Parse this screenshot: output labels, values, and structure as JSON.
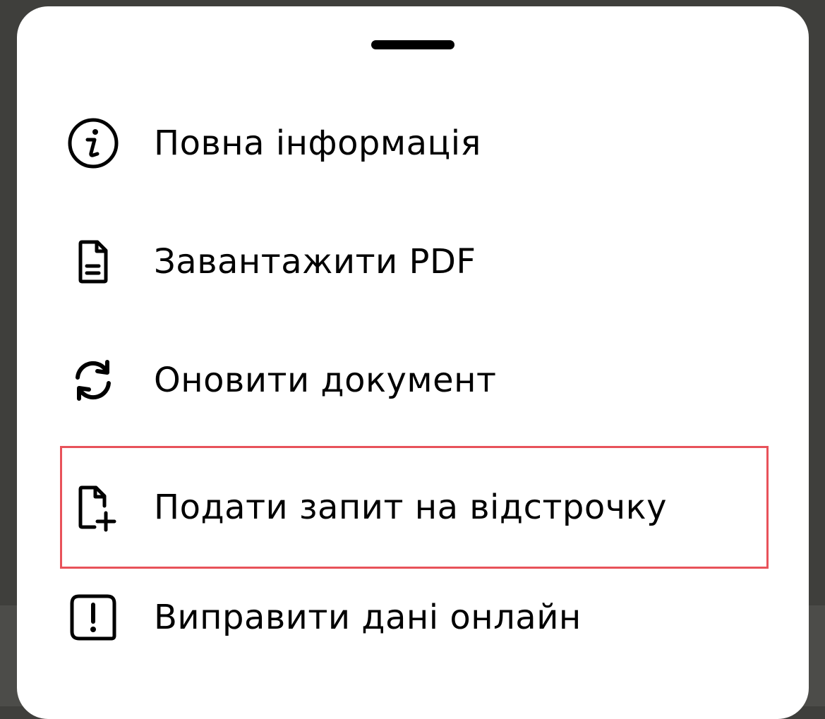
{
  "sheet": {
    "items": [
      {
        "label": "Повна інформація",
        "icon": "info-icon"
      },
      {
        "label": "Завантажити PDF",
        "icon": "document-icon"
      },
      {
        "label": "Оновити документ",
        "icon": "refresh-icon"
      },
      {
        "label": "Подати запит на відстрочку",
        "icon": "document-add-icon",
        "highlighted": true
      },
      {
        "label": "Виправити дані онлайн",
        "icon": "alert-icon"
      }
    ]
  },
  "colors": {
    "highlight_border": "#e8525a",
    "backdrop": "#3f3f3c",
    "sheet": "#ffffff"
  }
}
